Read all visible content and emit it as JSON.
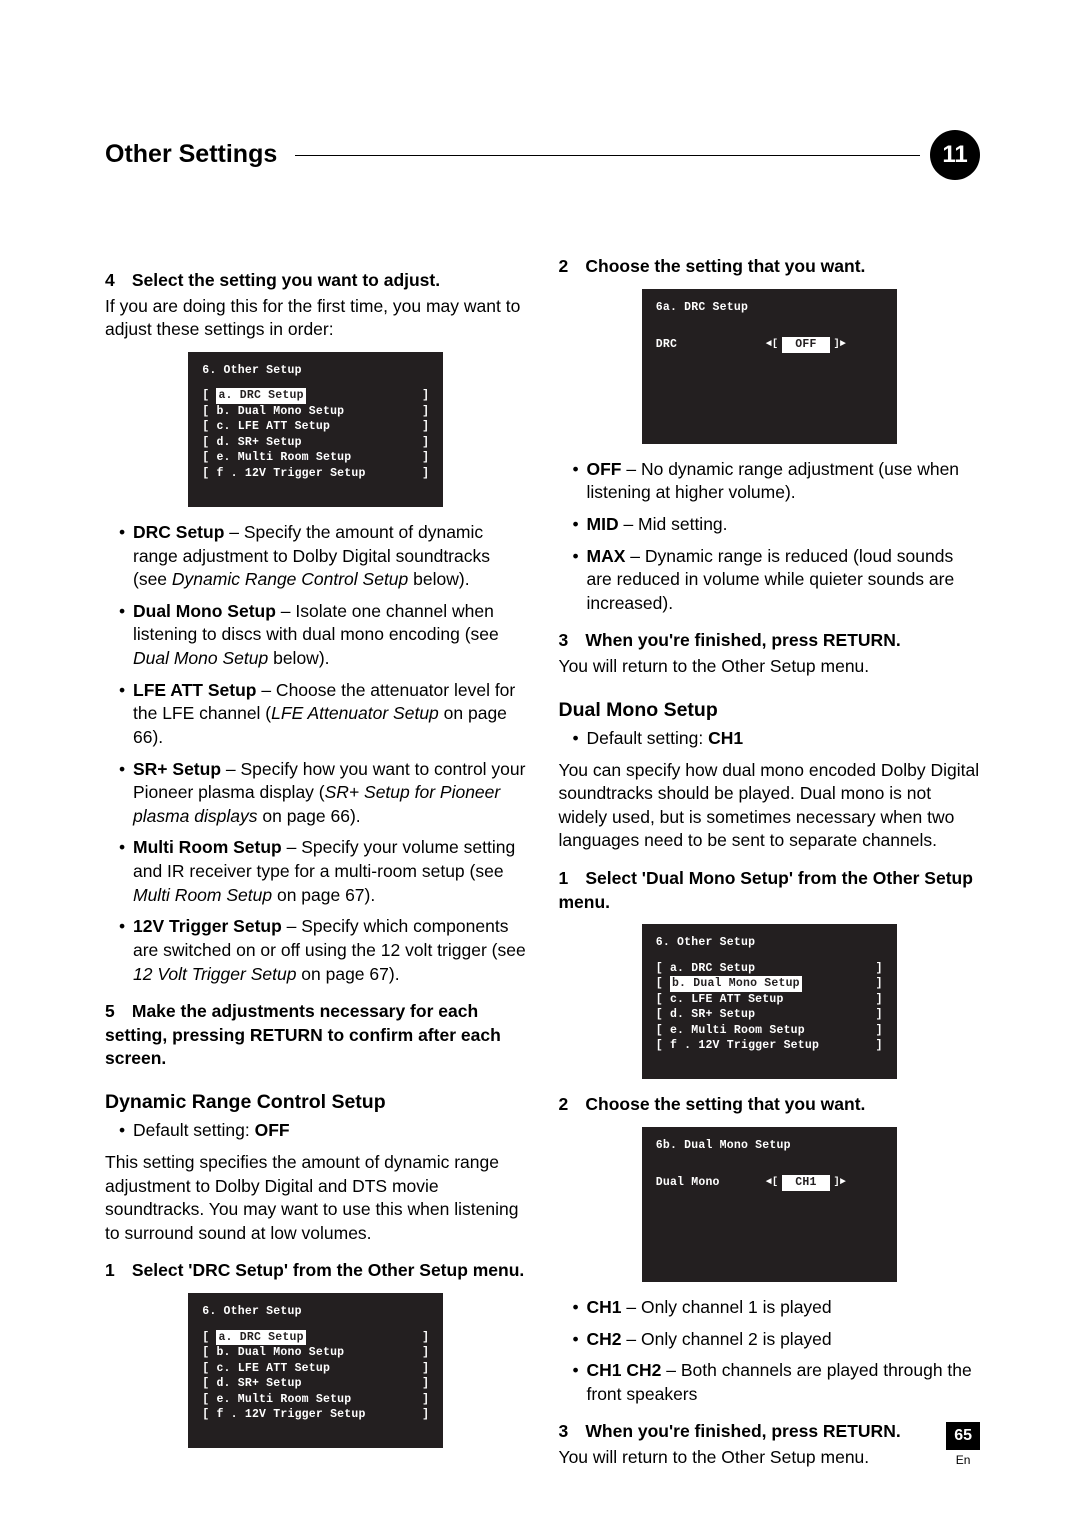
{
  "header": {
    "title": "Other Settings",
    "chapter": "11"
  },
  "left": {
    "step4_num": "4",
    "step4_title": "Select the setting you want to adjust.",
    "step4_body": "If you are doing this for the first time, you may want to adjust these settings in order:",
    "osd1": {
      "title": "6. Other Setup",
      "items": [
        {
          "l": "[ ",
          "t": "a. DRC Setup",
          "sel": true
        },
        {
          "l": "[ ",
          "t": "b. Dual Mono Setup"
        },
        {
          "l": "[ ",
          "t": "c. LFE ATT Setup"
        },
        {
          "l": "[ ",
          "t": "d. SR+ Setup"
        },
        {
          "l": "[ ",
          "t": "e. Multi Room Setup"
        },
        {
          "l": "[ ",
          "t": "f . 12V Trigger Setup"
        }
      ]
    },
    "bullets": [
      {
        "b": "DRC Setup",
        "t1": " – Specify the amount of dynamic range adjustment to Dolby Digital soundtracks (see ",
        "i": "Dynamic Range Control Setup",
        "t2": " below)."
      },
      {
        "b": "Dual Mono Setup",
        "t1": " – Isolate one channel when listening to discs with dual mono encoding (see ",
        "i": "Dual Mono Setup",
        "t2": " below)."
      },
      {
        "b": "LFE ATT Setup",
        "t1": " – Choose the attenuator level for the LFE channel (",
        "i": "LFE Attenuator Setup",
        "t2": " on page 66)."
      },
      {
        "b": "SR+ Setup",
        "t1": " – Specify how you want to control your Pioneer plasma display (",
        "i": "SR+ Setup for Pioneer plasma displays",
        "t2": " on page 66)."
      },
      {
        "b": "Multi Room Setup",
        "t1": " – Specify your volume setting and IR receiver type for a multi-room setup (see ",
        "i": "Multi Room Setup",
        "t2": " on page 67)."
      },
      {
        "b": "12V Trigger Setup",
        "t1": " – Specify which components are switched on or off using the 12 volt trigger (see ",
        "i": "12 Volt Trigger Setup",
        "t2": " on page 67)."
      }
    ],
    "step5_num": "5",
    "step5_title": "Make the adjustments necessary for each setting, pressing RETURN to confirm after each screen.",
    "drc_h": "Dynamic Range Control Setup",
    "drc_default_label": "Default setting: ",
    "drc_default_val": "OFF",
    "drc_body": "This setting specifies the amount of dynamic range adjustment to Dolby Digital and DTS movie soundtracks. You may want to use this when listening to surround sound at low volumes.",
    "drc_step1_num": "1",
    "drc_step1": "Select 'DRC Setup' from the Other Setup menu.",
    "osd2_selected": 0
  },
  "right": {
    "step2_num": "2",
    "step2_title": "Choose the setting that you want.",
    "osd_drc": {
      "title": "6a. DRC Setup",
      "label": "DRC",
      "value": "OFF"
    },
    "drc_opts": [
      {
        "b": "OFF",
        "t": " – No dynamic range adjustment (use when listening at higher volume)."
      },
      {
        "b": "MID",
        "t": " – Mid setting."
      },
      {
        "b": "MAX",
        "t": " – Dynamic range is reduced (loud sounds are reduced in volume while quieter sounds are increased)."
      }
    ],
    "step3_num": "3",
    "step3_title": "When you're finished, press RETURN.",
    "return_line": "You will return to the Other Setup menu.",
    "dm_h": "Dual Mono Setup",
    "dm_default_label": "Default setting: ",
    "dm_default_val": "CH1",
    "dm_body": "You can specify how dual mono encoded Dolby Digital soundtracks should be played. Dual mono is not widely used, but is sometimes necessary when two languages need to be sent to separate channels.",
    "dm_step1_num": "1",
    "dm_step1": "Select 'Dual Mono Setup' from the Other Setup menu.",
    "osd3_selected": 1,
    "dm_step2_num": "2",
    "dm_step2": "Choose the setting that you want.",
    "osd_dm": {
      "title": "6b. Dual Mono Setup",
      "label": "Dual Mono",
      "value": "CH1"
    },
    "dm_opts": [
      {
        "b": "CH1",
        "t": " – Only channel 1 is played"
      },
      {
        "b": "CH2",
        "t": " – Only channel 2 is played"
      },
      {
        "b": "CH1 CH2",
        "t": " – Both channels are played through the front speakers"
      }
    ],
    "dm_step3_num": "3",
    "dm_step3": "When you're finished, press RETURN.",
    "dm_return": "You will return to the Other Setup menu."
  },
  "footer": {
    "page": "65",
    "lang": "En"
  }
}
